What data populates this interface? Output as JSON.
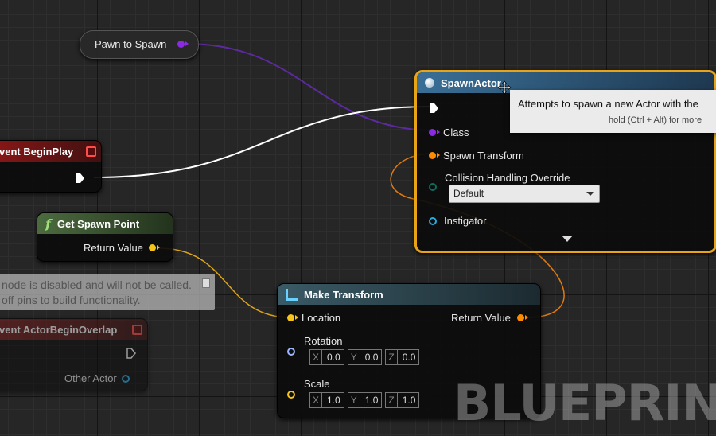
{
  "variable_node": {
    "label": "Pawn to Spawn",
    "pin_color": "#8a2be2"
  },
  "event_begin_play": {
    "title": "vent BeginPlay",
    "color": "#b01d1d"
  },
  "get_spawn_point": {
    "icon_glyph": "f",
    "title": "Get Spawn Point",
    "return_label": "Return Value",
    "color": "#4c6b3f"
  },
  "disabled_note": {
    "line1": "node is disabled and will not be called.",
    "line2": "off pins to build functionality."
  },
  "event_actor_overlap": {
    "title": "vent ActorBeginOverlap",
    "other_actor_label": "Other Actor",
    "color": "#7a1d1d"
  },
  "make_transform": {
    "title": "Make Transform",
    "location_label": "Location",
    "return_label": "Return Value",
    "rotation_label": "Rotation",
    "rotation": {
      "x_label": "X",
      "x": "0.0",
      "y_label": "Y",
      "y": "0.0",
      "z_label": "Z",
      "z": "0.0"
    },
    "scale_label": "Scale",
    "scale": {
      "x_label": "X",
      "x": "1.0",
      "y_label": "Y",
      "y": "1.0",
      "z_label": "Z",
      "z": "1.0"
    },
    "color": "#3a5a66"
  },
  "spawn_actor": {
    "title": "SpawnActor",
    "class_label": "Class",
    "spawn_transform_label": "Spawn Transform",
    "collision_label": "Collision Handling Override",
    "collision_value": "Default",
    "instigator_label": "Instigator",
    "color": "#3a6f96",
    "selection_color": "#e8a317"
  },
  "tooltip": {
    "line1": "Attempts to spawn a new Actor with the",
    "line2": "hold (Ctrl + Alt) for more"
  },
  "watermark": "BLUEPRINT",
  "colors": {
    "exec": "#ffffff",
    "class_pin": "#8a2be2",
    "transform_pin": "#ff8c00",
    "vector_pin": "#f5c518",
    "rotator_pin": "#9bb4ff",
    "object_pin": "#2aa9e0",
    "enum_pin": "#0a6e5e"
  }
}
